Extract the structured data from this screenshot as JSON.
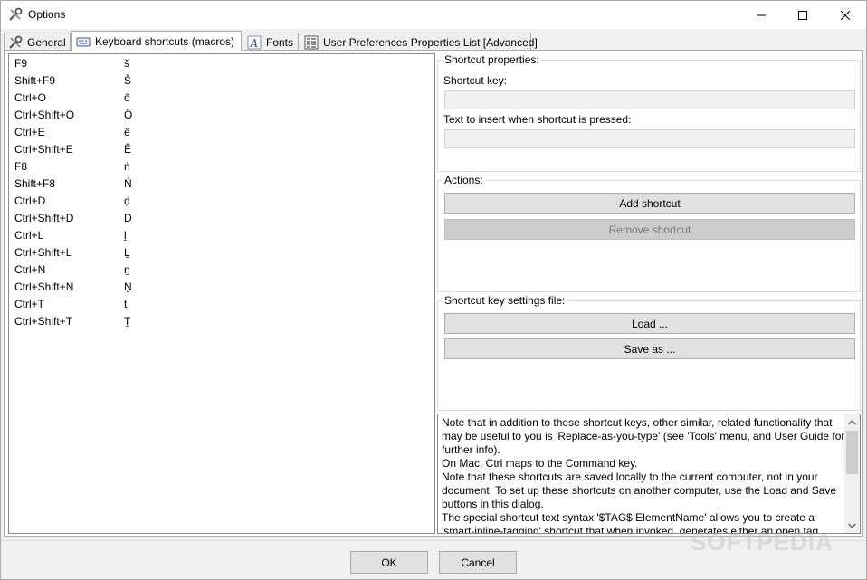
{
  "window": {
    "title": "Options"
  },
  "tabs": [
    {
      "label": "General",
      "icon": "tools-icon"
    },
    {
      "label": "Keyboard shortcuts (macros)",
      "icon": "keyboard-icon"
    },
    {
      "label": "Fonts",
      "icon": "font-icon"
    },
    {
      "label": "User Preferences Properties List [Advanced]",
      "icon": "list-icon"
    }
  ],
  "shortcuts": [
    {
      "key": "F9",
      "text": "š"
    },
    {
      "key": "Shift+F9",
      "text": "Š"
    },
    {
      "key": "Ctrl+O",
      "text": "ô"
    },
    {
      "key": "Ctrl+Shift+O",
      "text": "Ô"
    },
    {
      "key": "Ctrl+E",
      "text": "ê"
    },
    {
      "key": "Ctrl+Shift+E",
      "text": "Ê"
    },
    {
      "key": "F8",
      "text": "ṅ"
    },
    {
      "key": "Shift+F8",
      "text": "Ṅ"
    },
    {
      "key": "Ctrl+D",
      "text": "ḍ"
    },
    {
      "key": "Ctrl+Shift+D",
      "text": "Ḍ"
    },
    {
      "key": "Ctrl+L",
      "text": "ḻ"
    },
    {
      "key": "Ctrl+Shift+L",
      "text": "Ḻ"
    },
    {
      "key": "Ctrl+N",
      "text": "ṉ"
    },
    {
      "key": "Ctrl+Shift+N",
      "text": "Ṉ"
    },
    {
      "key": "Ctrl+T",
      "text": "ṯ"
    },
    {
      "key": "Ctrl+Shift+T",
      "text": "Ṯ"
    }
  ],
  "properties": {
    "title": "Shortcut properties:",
    "shortcut_key_label": "Shortcut key:",
    "shortcut_key_value": "",
    "text_label": "Text to insert when shortcut is pressed:",
    "text_value": ""
  },
  "actions": {
    "title": "Actions:",
    "add_label": "Add shortcut",
    "remove_label": "Remove shortcut"
  },
  "settings_file": {
    "title": "Shortcut key settings file:",
    "load_label": "Load ...",
    "save_label": "Save as ..."
  },
  "notes": [
    "Note that in addition to these shortcut keys, other similar, related functionality that",
    "may be useful to you is 'Replace-as-you-type' (see 'Tools' menu, and User Guide for",
    "further info).",
    "On Mac, Ctrl maps to the Command key.",
    "Note that these shortcuts are saved locally to the current computer, not in your",
    "document. To set up these shortcuts on another computer, use the Load and Save",
    "buttons in this dialog.",
    "The special shortcut text syntax '$TAG$:ElementName' allows you to create a",
    "'smart-inline-tagging' shortcut that when invoked, generates either an open tag"
  ],
  "footer": {
    "ok_label": "OK",
    "cancel_label": "Cancel"
  },
  "watermark": "SOFTPEDIA"
}
